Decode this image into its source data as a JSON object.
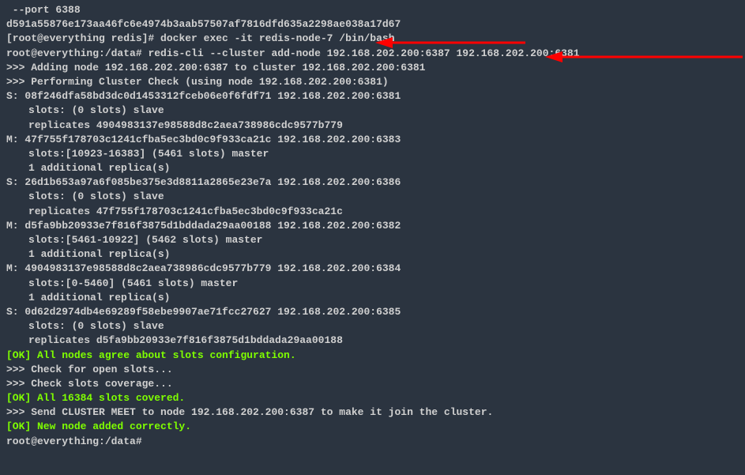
{
  "lines": {
    "l1": " --port 6388",
    "l2": "d591a55876e173aa46fc6e4974b3aab57507af7816dfd635a2298ae038a17d67",
    "l3_prompt": "[root@everything redis]# ",
    "l3_cmd": "docker exec -it redis-node-7 /bin/bash",
    "l4_prompt": "root@everything:/data# ",
    "l4_cmd": "redis-cli --cluster add-node 192.168.202.200:6387 192.168.202.200:6381",
    "l5": ">>> Adding node 192.168.202.200:6387 to cluster 192.168.202.200:6381",
    "l6": ">>> Performing Cluster Check (using node 192.168.202.200:6381)",
    "l7": "S: 08f246dfa58bd3dc0d1453312fceb06e0f6fdf71 192.168.202.200:6381",
    "l8": "slots: (0 slots) slave",
    "l9": "replicates 4904983137e98588d8c2aea738986cdc9577b779",
    "l10": "M: 47f755f178703c1241cfba5ec3bd0c9f933ca21c 192.168.202.200:6383",
    "l11": "slots:[10923-16383] (5461 slots) master",
    "l12": "1 additional replica(s)",
    "l13": "S: 26d1b653a97a6f085be375e3d8811a2865e23e7a 192.168.202.200:6386",
    "l14": "slots: (0 slots) slave",
    "l15": "replicates 47f755f178703c1241cfba5ec3bd0c9f933ca21c",
    "l16": "M: d5fa9bb20933e7f816f3875d1bddada29aa00188 192.168.202.200:6382",
    "l17": "slots:[5461-10922] (5462 slots) master",
    "l18": "1 additional replica(s)",
    "l19": "M: 4904983137e98588d8c2aea738986cdc9577b779 192.168.202.200:6384",
    "l20": "slots:[0-5460] (5461 slots) master",
    "l21": "1 additional replica(s)",
    "l22": "S: 0d62d2974db4e69289f58ebe9907ae71fcc27627 192.168.202.200:6385",
    "l23": "slots: (0 slots) slave",
    "l24": "replicates d5fa9bb20933e7f816f3875d1bddada29aa00188",
    "l25": "[OK] All nodes agree about slots configuration.",
    "l26": ">>> Check for open slots...",
    "l27": ">>> Check slots coverage...",
    "l28": "[OK] All 16384 slots covered.",
    "l29": ">>> Send CLUSTER MEET to node 192.168.202.200:6387 to make it join the cluster.",
    "l30": "[OK] New node added correctly.",
    "l31": "root@everything:/data#"
  }
}
